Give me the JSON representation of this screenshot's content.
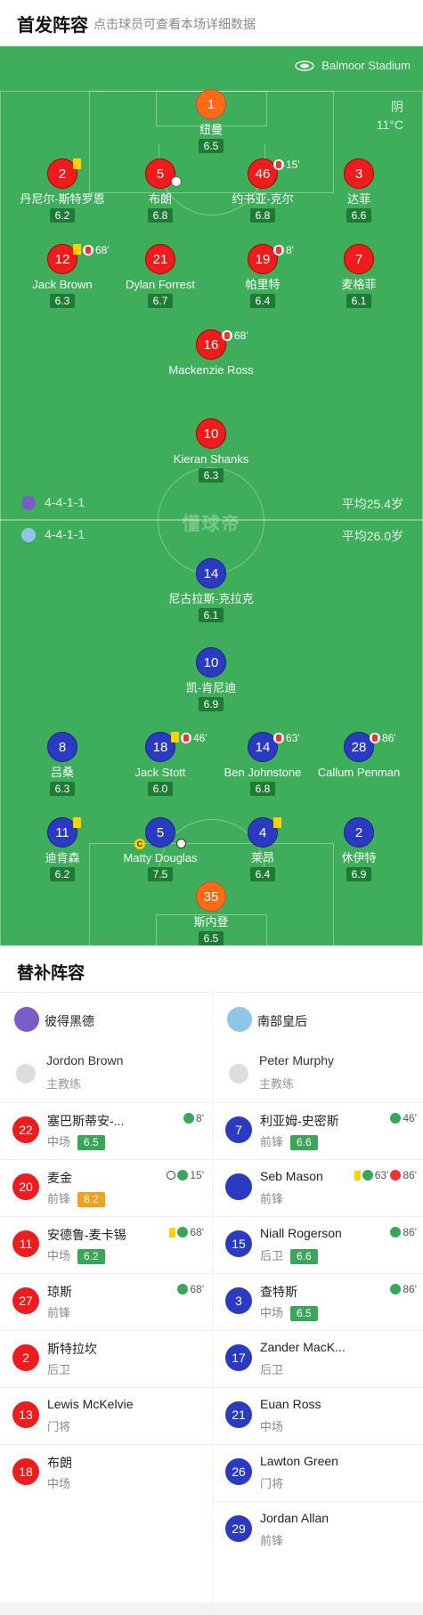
{
  "header": {
    "title": "首发阵容",
    "subtitle": "点击球员可查看本场详细数据"
  },
  "venue": {
    "stadium": "Balmoor Stadium",
    "weather": "阴",
    "temp": "11°C"
  },
  "watermark": "懂球帝",
  "home": {
    "formation": "4-4-1-1",
    "avg_age": "平均25.4岁",
    "players": [
      {
        "num": "1",
        "name": "纽曼",
        "rating": "6.5",
        "color": "orange"
      },
      {
        "num": "2",
        "name": "丹尼尔-斯特罗恩",
        "rating": "6.2",
        "color": "red"
      },
      {
        "num": "5",
        "name": "布朗",
        "rating": "6.8",
        "color": "red"
      },
      {
        "num": "46",
        "name": "约书亚-克尔",
        "rating": "6.8",
        "color": "red",
        "sub": "15'"
      },
      {
        "num": "3",
        "name": "达菲",
        "rating": "6.6",
        "color": "red"
      },
      {
        "num": "12",
        "name": "Jack Brown",
        "rating": "6.3",
        "color": "red",
        "sub": "68'"
      },
      {
        "num": "21",
        "name": "Dylan Forrest",
        "rating": "6.7",
        "color": "red"
      },
      {
        "num": "19",
        "name": "帕里特",
        "rating": "6.4",
        "color": "red",
        "sub": "8'"
      },
      {
        "num": "7",
        "name": "麦格菲",
        "rating": "6.1",
        "color": "red"
      },
      {
        "num": "16",
        "name": "Mackenzie Ross",
        "rating": "",
        "color": "red",
        "sub": "68'"
      },
      {
        "num": "10",
        "name": "Kieran Shanks",
        "rating": "6.3",
        "color": "red"
      }
    ]
  },
  "away": {
    "formation": "4-4-1-1",
    "avg_age": "平均26.0岁",
    "players": [
      {
        "num": "14",
        "name": "尼古拉斯-克拉克",
        "rating": "6.1"
      },
      {
        "num": "10",
        "name": "凯-肯尼迪",
        "rating": "6.9"
      },
      {
        "num": "8",
        "name": "吕桑",
        "rating": "6.3"
      },
      {
        "num": "18",
        "name": "Jack Stott",
        "rating": "6.0",
        "sub": "46'"
      },
      {
        "num": "14",
        "name": "Ben Johnstone",
        "rating": "6.8",
        "sub": "63'"
      },
      {
        "num": "28",
        "name": "Callum Penman",
        "rating": "",
        "sub": "86'"
      },
      {
        "num": "11",
        "name": "迪肯森",
        "rating": "6.2"
      },
      {
        "num": "5",
        "name": "Matty Douglas",
        "rating": "7.5",
        "captain": "C"
      },
      {
        "num": "4",
        "name": "莱昂",
        "rating": "6.4"
      },
      {
        "num": "2",
        "name": "休伊特",
        "rating": "6.9"
      },
      {
        "num": "35",
        "name": "斯内登",
        "rating": "6.5"
      }
    ]
  },
  "subs": {
    "title": "替补阵容",
    "home": {
      "team": "彼得黑德",
      "coach": {
        "name": "Jordon Brown",
        "role": "主教练"
      },
      "list": [
        {
          "num": "22",
          "name": "塞巴斯蒂安-...",
          "pos": "中场",
          "rating": "6.5",
          "rating_color": "#3aa65a",
          "ev": "8'"
        },
        {
          "num": "20",
          "name": "麦金",
          "pos": "前锋",
          "rating": "8.2",
          "rating_color": "#f0a020",
          "ev": "15'"
        },
        {
          "num": "11",
          "name": "安德鲁-麦卡锡",
          "pos": "中场",
          "rating": "6.2",
          "rating_color": "#3aa65a",
          "ev": "68'"
        },
        {
          "num": "27",
          "name": "琼斯",
          "pos": "前锋",
          "rating": "",
          "ev": "68'"
        },
        {
          "num": "2",
          "name": "斯特拉坎",
          "pos": "后卫",
          "rating": ""
        },
        {
          "num": "13",
          "name": "Lewis McKelvie",
          "pos": "门将",
          "rating": ""
        },
        {
          "num": "18",
          "name": "布朗",
          "pos": "中场",
          "rating": ""
        }
      ]
    },
    "away": {
      "team": "南部皇后",
      "coach": {
        "name": "Peter Murphy",
        "role": "主教练"
      },
      "list": [
        {
          "num": "7",
          "name": "利亚姆-史密斯",
          "pos": "前锋",
          "rating": "6.6",
          "rating_color": "#3aa65a",
          "ev": "46'"
        },
        {
          "num": "",
          "name": "Seb Mason",
          "pos": "前锋",
          "rating": "",
          "ev": "63'",
          "ev2": "86'"
        },
        {
          "num": "15",
          "name": "Niall Rogerson",
          "pos": "后卫",
          "rating": "6.6",
          "rating_color": "#3aa65a",
          "ev": "86'"
        },
        {
          "num": "3",
          "name": "查特斯",
          "pos": "中场",
          "rating": "6.5",
          "rating_color": "#3aa65a",
          "ev": "86'"
        },
        {
          "num": "17",
          "name": "Zander MacK...",
          "pos": "后卫",
          "rating": ""
        },
        {
          "num": "21",
          "name": "Euan Ross",
          "pos": "中场",
          "rating": ""
        },
        {
          "num": "26",
          "name": "Lawton Green",
          "pos": "门将",
          "rating": ""
        },
        {
          "num": "29",
          "name": "Jordan Allan",
          "pos": "前锋",
          "rating": ""
        }
      ]
    }
  },
  "colors": {
    "home": "#ee1c1c",
    "away": "#2b3bc1",
    "keeper": "#ff6a13",
    "pitch": "#3fae5a"
  }
}
